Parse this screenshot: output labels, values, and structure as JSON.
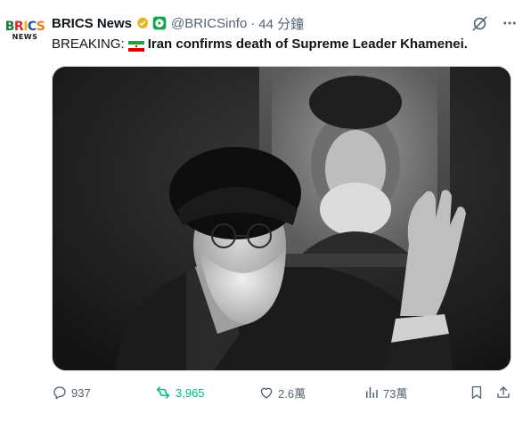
{
  "account": {
    "display_name": "BRICS News",
    "handle": "@BRICSinfo",
    "separator": "·",
    "time": "44 分鐘",
    "avatar_text_top": "BRICS",
    "avatar_text_bottom": "NEWS"
  },
  "tweet": {
    "prefix": "BREAKING:",
    "flag_icon": "iran-flag-icon",
    "body": "Iran confirms death of Supreme Leader Khamenei."
  },
  "media": {
    "type": "photo",
    "style": "black-and-white"
  },
  "actions": {
    "replies": "937",
    "reposts": "3,965",
    "likes": "2.6萬",
    "views": "73萬"
  },
  "colors": {
    "text": "#0f1419",
    "muted": "#536471",
    "repost_active": "#00ba7c",
    "verified_gold": "#e2b719",
    "brics_colors": [
      "#1d7a3a",
      "#d62b2b",
      "#f2b705",
      "#1f4fa3",
      "#e67e22"
    ]
  }
}
